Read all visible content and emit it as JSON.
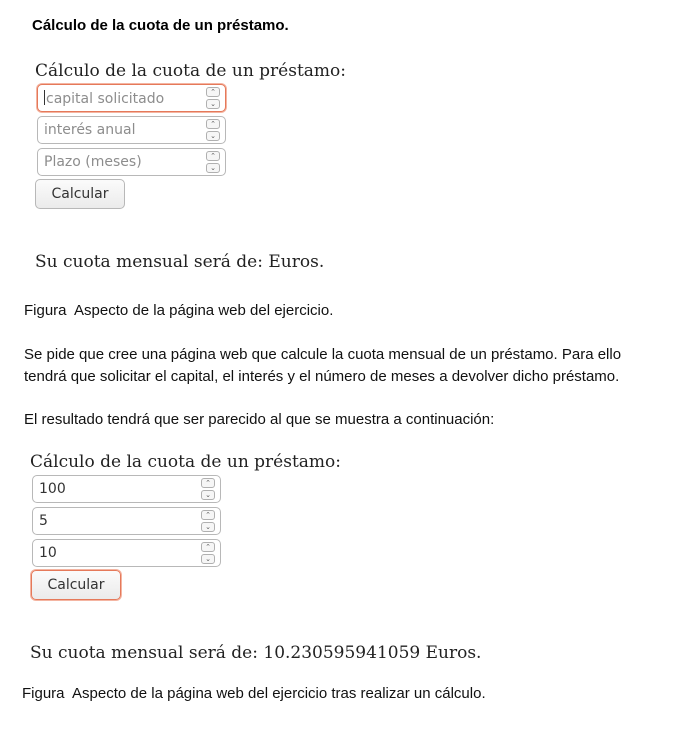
{
  "heading": "Cálculo de la cuota de un préstamo.",
  "figure1": {
    "form_title": "Cálculo de la cuota de un préstamo:",
    "inputs": [
      {
        "placeholder": "capital solicitado",
        "value": ""
      },
      {
        "placeholder": "interés anual",
        "value": ""
      },
      {
        "placeholder": "Plazo (meses)",
        "value": ""
      }
    ],
    "button_label": "Calcular",
    "result": "Su cuota mensual será de: Euros.",
    "caption_label": "Figura",
    "caption_text": "Aspecto de la página web del ejercicio."
  },
  "paragraph1": [
    "Se pide que cree una página web que calcule la cuota mensual de un préstamo. Para ello",
    "tendrá que solicitar el capital, el interés y el número de meses a devolver dicho préstamo."
  ],
  "paragraph2": "El resultado tendrá que ser parecido al que se muestra a continuación:",
  "figure2": {
    "form_title": "Cálculo de la cuota de un préstamo:",
    "inputs": [
      {
        "value": "100"
      },
      {
        "value": "5"
      },
      {
        "value": "10"
      }
    ],
    "button_label": "Calcular",
    "result": "Su cuota mensual será de: 10.230595941059 Euros.",
    "caption_label": "Figura",
    "caption_text": "Aspecto de la página web del ejercicio tras realizar un cálculo."
  },
  "icons": {
    "spin_up": "chevron-up-icon",
    "spin_down": "chevron-down-icon"
  }
}
